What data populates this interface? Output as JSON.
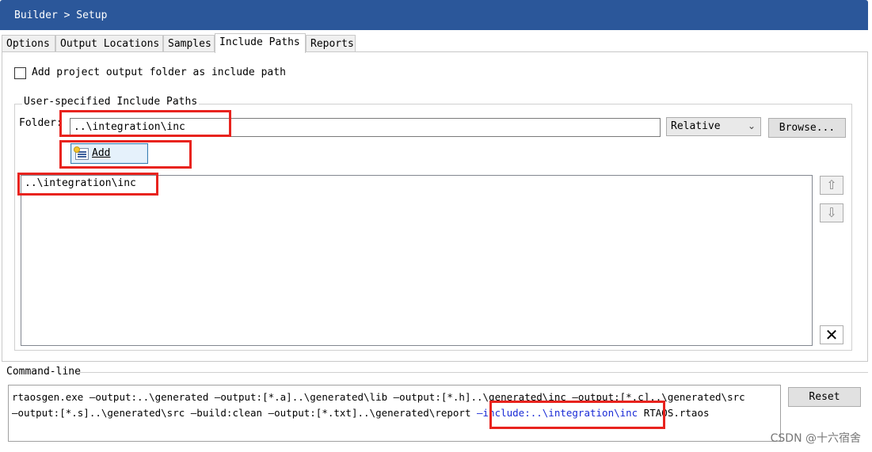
{
  "window": {
    "breadcrumb": "Builder > Setup"
  },
  "tabs": [
    {
      "label": "Options",
      "active": false
    },
    {
      "label": "Output Locations",
      "active": false
    },
    {
      "label": "Samples",
      "active": false
    },
    {
      "label": "Include Paths",
      "active": true
    },
    {
      "label": "Reports",
      "active": false
    }
  ],
  "include_paths": {
    "add_output_folder_label": "Add project output folder as include path",
    "add_output_folder_checked": false,
    "group_title": "User-specified Include Paths",
    "folder_label": "Folder:",
    "folder_value": "..\\integration\\inc",
    "path_mode": "Relative",
    "browse_label": "Browse...",
    "add_label": "Add",
    "paths": [
      "..\\integration\\inc"
    ],
    "move_up_icon": "arrow-up-icon",
    "move_down_icon": "arrow-down-icon",
    "delete_icon": "x-icon"
  },
  "command_line": {
    "label": "Command-line",
    "line1": "rtaosgen.exe —output:..\\generated —output:[*.a]..\\generated\\lib —output:[*.h]..\\generated\\inc —output:[*.c]..\\generated\\src",
    "line2_pre": "—output:[*.s]..\\generated\\src —build:clean —output:[*.txt]..\\generated\\report ",
    "line2_include": "—include:..\\integration\\inc",
    "line2_post": " RTAOS.rtaos",
    "reset_label": "Reset"
  },
  "colors": {
    "titlebar": "#2b579a",
    "highlight_box": "#e8231e",
    "include_text": "#1a2bd6"
  },
  "watermark": "CSDN @十六宿舍"
}
